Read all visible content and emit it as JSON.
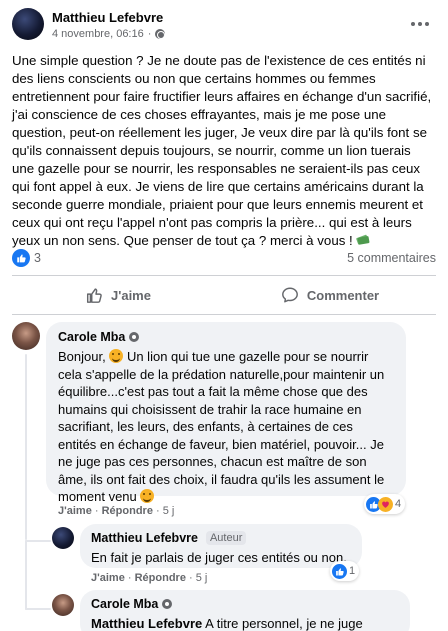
{
  "post": {
    "author": "Matthieu Lefebvre",
    "date": "4 novembre, 06:16",
    "date_separator": "·",
    "text": "Une simple question ? Je ne doute pas de l'existence de ces entités ni des liens conscients ou non que certains hommes ou femmes entretiennent pour faire fructifier leurs affaires en échange d'un sacrifié, j'ai conscience de ces choses effrayantes, mais je me pose une question, peut-on réellement les juger, Je veux dire par là qu'ils font se qu'ils connaissent depuis toujours, se nourrir, comme un lion tuerais une gazelle pour se nourrir, les responsables ne seraient-ils pas ceux qui font appel à eux. Je viens de lire que certains américains durant la seconde guerre mondiale, priaient pour que leurs ennemis meurent et ceux qui ont reçu l'appel n'ont pas compris la prière... qui est à leurs yeux un non sens. Que penser de tout ça ? merci à vous !",
    "like_count": "3",
    "comments_count": "5 commentaires"
  },
  "actions": {
    "like_label": "J'aime",
    "comment_label": "Commenter"
  },
  "comments": [
    {
      "author": "Carole Mba",
      "text_before_emoji": "Bonjour,",
      "text": "Un lion qui tue une gazelle pour se nourrir cela s'appelle de la prédation naturelle,pour maintenir un équilibre...c'est pas tout a fait la même chose que des humains qui choisissent de trahir la race humaine en sacrifiant, les leurs, des enfants, à certaines de ces entités en échange de faveur, bien matériel, pouvoir... Je ne juge pas ces personnes, chacun est maître de son âme, ils ont fait des choix, il faudra qu'ils les assument le moment venu",
      "like": "J'aime",
      "reply": "Répondre",
      "time": "5 j",
      "reaction_count": "4"
    },
    {
      "author": "Matthieu Lefebvre",
      "tag": "Auteur",
      "text": "En fait je parlais de juger ces entités ou non.",
      "like": "J'aime",
      "reply": "Répondre",
      "time": "5 j",
      "reaction_count": "1"
    },
    {
      "author": "Carole Mba",
      "mention": "Matthieu Lefebvre",
      "text": "A titre personnel, je ne juge"
    }
  ],
  "separator": "·",
  "colors": {
    "accent": "#1877f2",
    "muted": "#65676b",
    "bubble": "#f0f2f5"
  }
}
